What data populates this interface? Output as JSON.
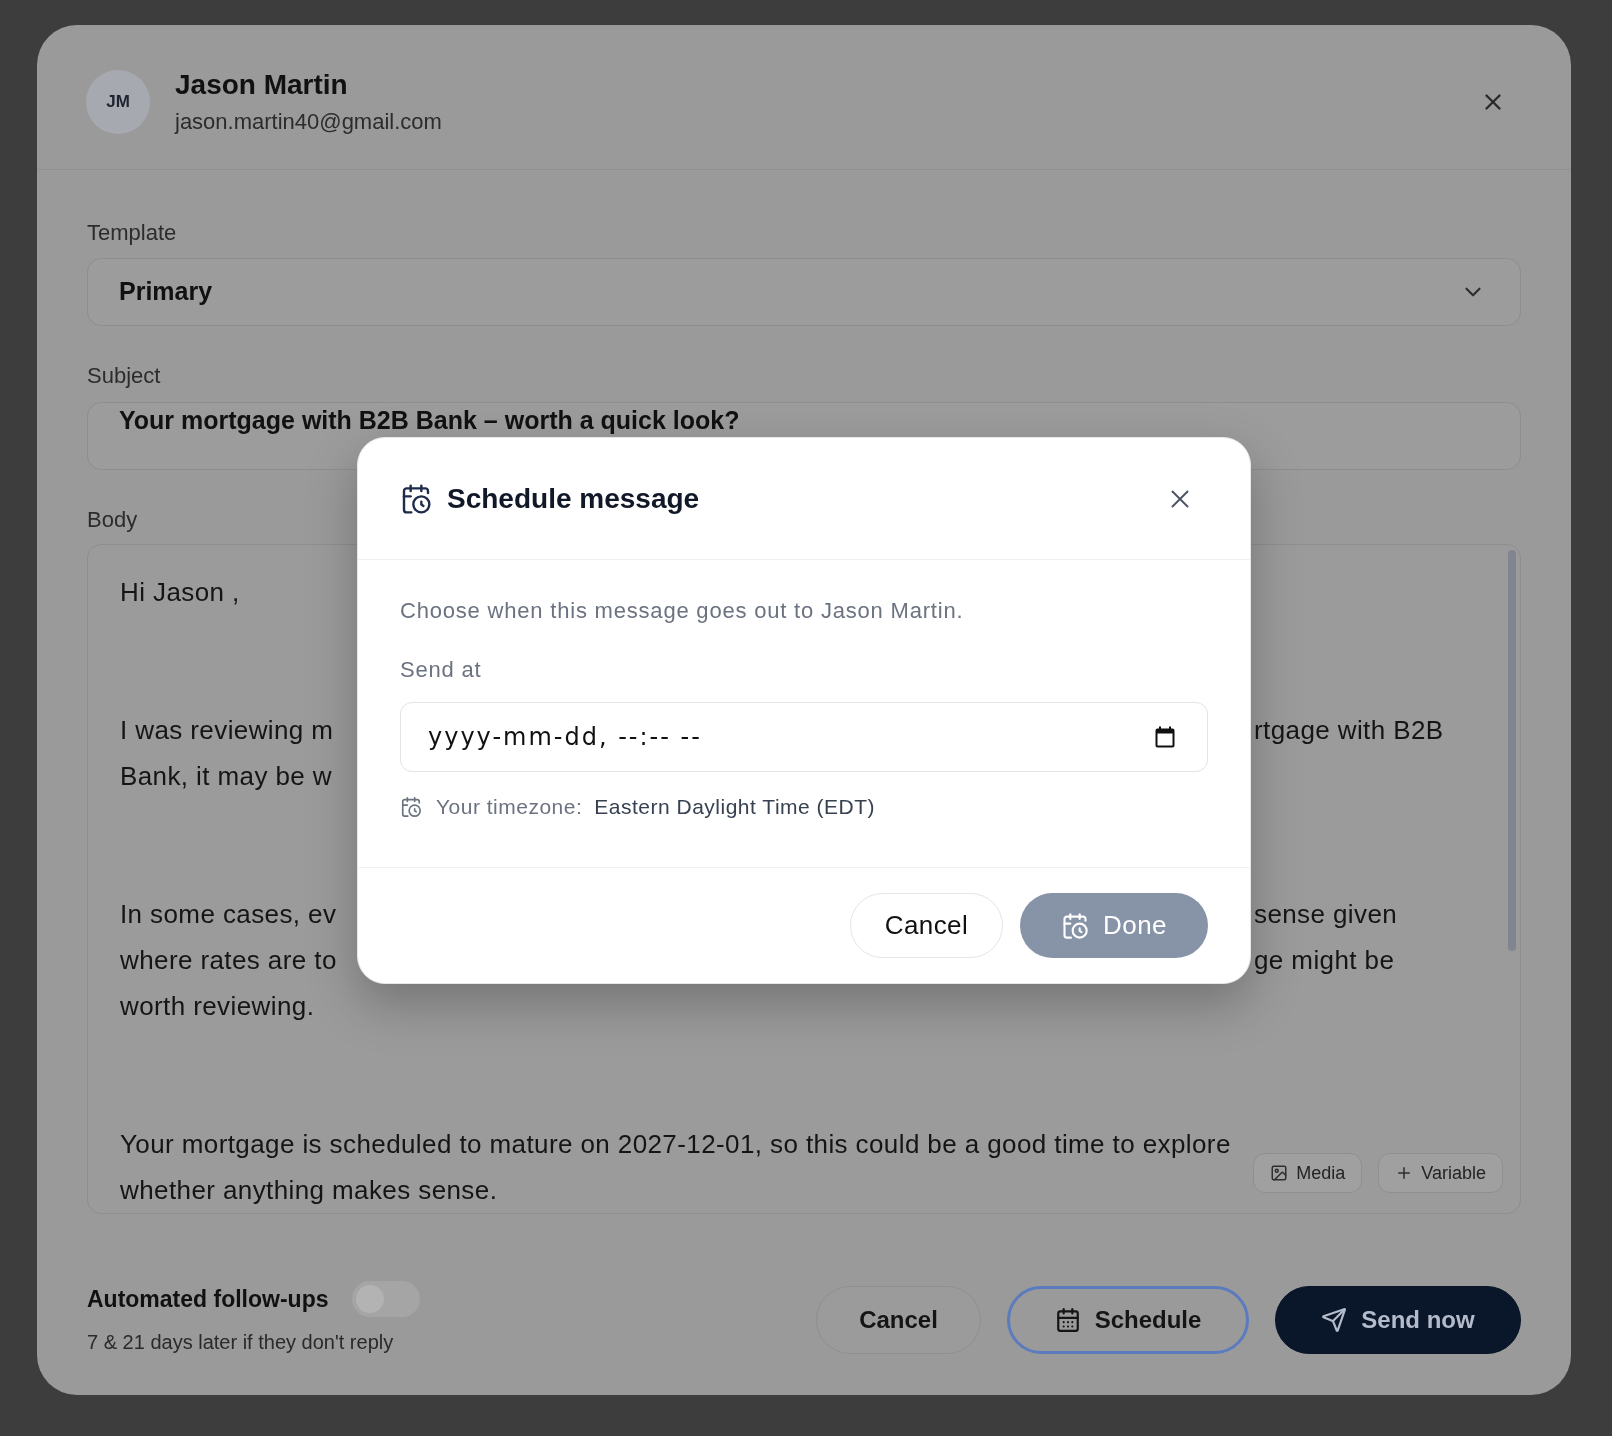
{
  "contact_dialog": {
    "avatar_initials": "JM",
    "name": "Jason Martin",
    "email": "jason.martin40@gmail.com",
    "template": {
      "label": "Template",
      "value": "Primary"
    },
    "subject": {
      "label": "Subject",
      "value": "Your mortgage with B2B Bank – worth a quick look?"
    },
    "body": {
      "label": "Body",
      "paragraphs": [
        {
          "lines": [
            {
              "left": "Hi Jason ,"
            }
          ]
        },
        {
          "lines": [
            {
              "left": "I was reviewing m",
              "right": "rtgage with B2B"
            },
            {
              "left": "Bank, it may be w"
            }
          ]
        },
        {
          "lines": [
            {
              "left": "In some cases, ev",
              "right": "sense given"
            },
            {
              "left": "where rates are to",
              "right": "ge might be"
            },
            {
              "left": "worth reviewing."
            }
          ]
        },
        {
          "lines": [
            {
              "left": "Your mortgage is scheduled to mature on 2027-12-01, so this could be a good time to explore"
            },
            {
              "left": "whether anything makes sense."
            }
          ]
        }
      ],
      "tools": [
        {
          "kind": "media",
          "label": "Media"
        },
        {
          "kind": "variable",
          "label": "Variable"
        }
      ]
    },
    "follow_ups": {
      "title": "Automated follow-ups",
      "on": false,
      "hint": "7 & 21 days later if they don't reply"
    },
    "actions": [
      {
        "kind": "cancel",
        "label": "Cancel",
        "focused": false
      },
      {
        "kind": "schedule",
        "label": "Schedule",
        "focused": true
      },
      {
        "kind": "send",
        "label": "Send now",
        "focused": false
      }
    ]
  },
  "schedule_modal": {
    "title": "Schedule message",
    "description": "Choose when this message goes out to Jason Martin.",
    "send_at": {
      "label": "Send at",
      "placeholder": "yyyy-mm-dd, --:-- --"
    },
    "timezone": {
      "label": "Your timezone:",
      "value": "Eastern Daylight Time (EDT)"
    },
    "buttons": [
      {
        "kind": "cancel",
        "label": "Cancel",
        "disabled": false
      },
      {
        "kind": "done",
        "label": "Done",
        "disabled": true
      }
    ]
  }
}
